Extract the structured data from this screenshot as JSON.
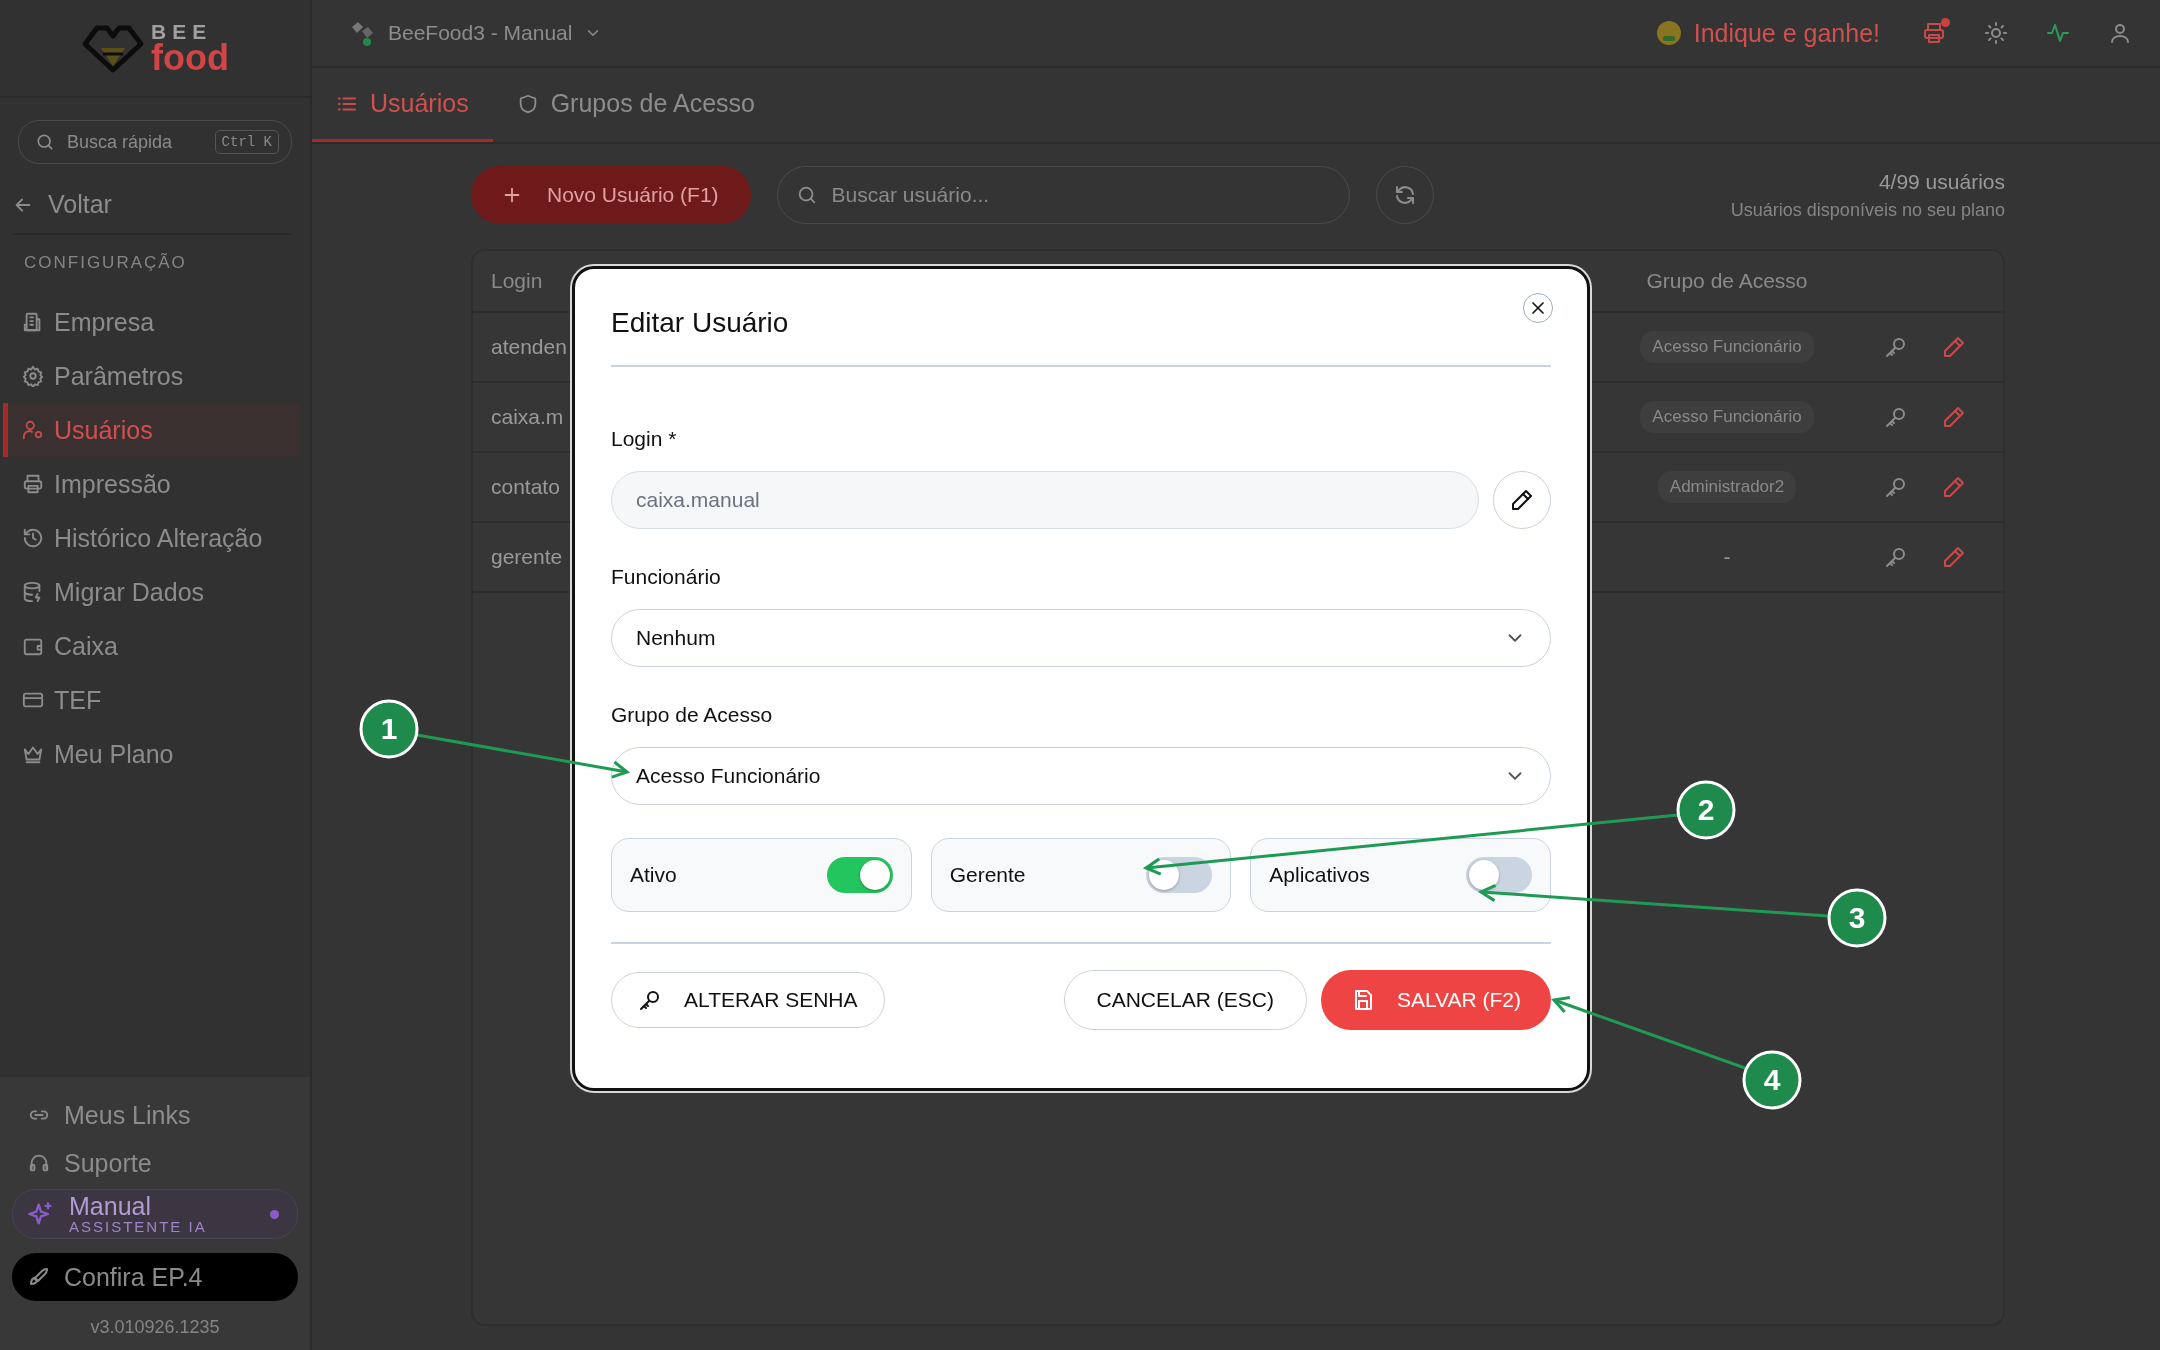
{
  "sidebar": {
    "logo": {
      "line_1": "BEE",
      "line_2": "food"
    },
    "search": {
      "placeholder": "Busca rápida",
      "shortcut": "Ctrl K"
    },
    "back": "Voltar",
    "section": "CONFIGURAÇÃO",
    "items": [
      {
        "label": "Empresa",
        "selected": false
      },
      {
        "label": "Parâmetros",
        "selected": false
      },
      {
        "label": "Usuários",
        "selected": true
      },
      {
        "label": "Impressão",
        "selected": false
      },
      {
        "label": "Histórico Alteração",
        "selected": false
      },
      {
        "label": "Migrar Dados",
        "selected": false
      },
      {
        "label": "Caixa",
        "selected": false
      },
      {
        "label": "TEF",
        "selected": false
      },
      {
        "label": "Meu Plano",
        "selected": false
      }
    ],
    "footer_links": [
      "Meus Links",
      "Suporte"
    ],
    "assistant": {
      "title": "Manual",
      "subtitle": "ASSISTENTE IA"
    },
    "promo": "Confira EP.4",
    "version": "v3.010926.1235"
  },
  "header": {
    "workspace": "BeeFood3 - Manual",
    "referral": "Indique e ganhe!"
  },
  "tabs": [
    {
      "label": "Usuários",
      "selected": true
    },
    {
      "label": "Grupos de Acesso",
      "selected": false
    }
  ],
  "toolbar": {
    "new_button": "Novo Usuário (F1)",
    "search_placeholder": "Buscar usuário...",
    "count": "4/99 usuários",
    "count_note": "Usuários disponíveis no seu plano"
  },
  "table": {
    "columns": [
      "Login",
      "Grupo de Acesso"
    ],
    "rows": [
      {
        "login": "atenden",
        "group": "Acesso Funcionário"
      },
      {
        "login": "caixa.m",
        "group": "Acesso Funcionário"
      },
      {
        "login": "contato",
        "group": "Administrador2"
      },
      {
        "login": "gerente",
        "group": "-"
      }
    ]
  },
  "dialog": {
    "title": "Editar Usuário",
    "fields": [
      {
        "kind": "text",
        "label": "Login *",
        "value": "caixa.manual",
        "disabled": true
      },
      {
        "kind": "select",
        "label": "Funcionário",
        "value": "Nenhum"
      },
      {
        "kind": "select",
        "label": "Grupo de Acesso",
        "value": "Acesso Funcionário"
      }
    ],
    "toggles": [
      {
        "label": "Ativo",
        "on": true
      },
      {
        "label": "Gerente",
        "on": false
      },
      {
        "label": "Aplicativos",
        "on": false
      }
    ],
    "buttons": [
      {
        "kind": "secondary",
        "label": "ALTERAR SENHA"
      },
      {
        "kind": "outline",
        "label": "CANCELAR (ESC)"
      },
      {
        "kind": "primary",
        "label": "SALVAR (F2)"
      }
    ]
  },
  "annotations": [
    {
      "label": "1"
    },
    {
      "label": "2"
    },
    {
      "label": "3"
    },
    {
      "label": "4"
    }
  ]
}
